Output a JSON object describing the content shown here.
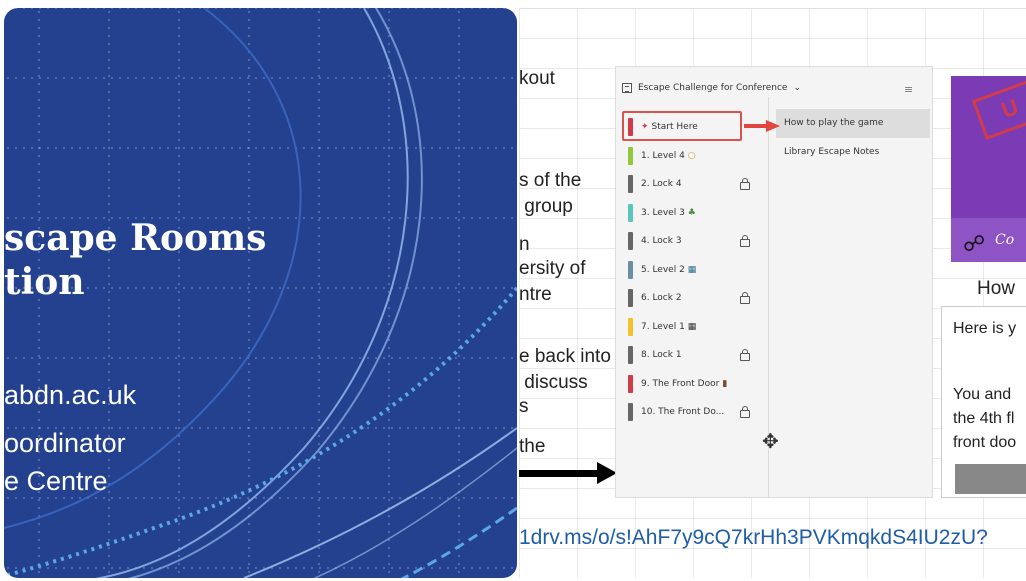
{
  "slide": {
    "title_line1": "scape Rooms",
    "title_line2": "tion",
    "email": "abdn.ac.uk",
    "role_line1": "oordinator",
    "role_line2": "e Centre",
    "colors": {
      "background": "#23418f",
      "accent": "#5aa8e6"
    }
  },
  "document": {
    "lines": [
      "kout",
      "s of the",
      " group",
      "n",
      "ersity of",
      "ntre",
      "e back into",
      " discuss",
      "s",
      "the"
    ],
    "url": "1drv.ms/o/s!AhF7y9cQ7krHh3PVKmqkdS4IU2zU?"
  },
  "onenote": {
    "notebook_title": "Escape Challenge for Conference",
    "sections": [
      {
        "label": "Start Here",
        "color": "#d23b4a",
        "locked": false,
        "icon": "pin-icon"
      },
      {
        "label": "1. Level 4",
        "color": "#92c83e",
        "locked": false,
        "icon": "bulb-icon"
      },
      {
        "label": "2. Lock 4",
        "color": "#666666",
        "locked": true,
        "icon": ""
      },
      {
        "label": "3. Level 3",
        "color": "#5bc4bf",
        "locked": false,
        "icon": "puzzle-icon"
      },
      {
        "label": "4. Lock 3",
        "color": "#666666",
        "locked": true,
        "icon": ""
      },
      {
        "label": "5. Level 2",
        "color": "#6a8fa1",
        "locked": false,
        "icon": "door-icon"
      },
      {
        "label": "6. Lock 2",
        "color": "#666666",
        "locked": true,
        "icon": ""
      },
      {
        "label": "7. Level 1",
        "color": "#f2c12e",
        "locked": false,
        "icon": "calendar-icon"
      },
      {
        "label": "8. Lock 1",
        "color": "#666666",
        "locked": true,
        "icon": ""
      },
      {
        "label": "9. The Front Door",
        "color": "#d23b4a",
        "locked": false,
        "icon": "door-icon"
      },
      {
        "label": "10. The Front Do...",
        "color": "#666666",
        "locked": true,
        "icon": ""
      }
    ],
    "pages": [
      {
        "label": "How to play the game"
      },
      {
        "label": "Library Escape Notes"
      }
    ]
  },
  "preview": {
    "stamp": "U",
    "card_text": "Co",
    "heading": "How",
    "line1": "Here is y",
    "line2": "You and",
    "line3": "the 4th fl",
    "line4": "front doo"
  }
}
